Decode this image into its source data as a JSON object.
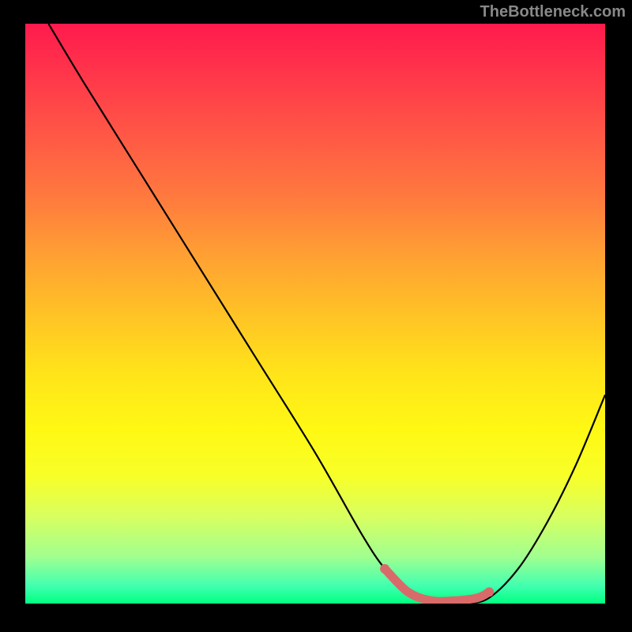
{
  "watermark": "TheBottleneck.com",
  "chart_data": {
    "type": "line",
    "title": "",
    "xlabel": "",
    "ylabel": "",
    "xlim": [
      0,
      100
    ],
    "ylim": [
      0,
      100
    ],
    "series": [
      {
        "name": "bottleneck-curve",
        "x": [
          4,
          10,
          20,
          30,
          40,
          50,
          58,
          62,
          66,
          72,
          76,
          80,
          85,
          90,
          95,
          100
        ],
        "y": [
          100,
          90,
          74,
          58,
          42,
          26,
          12,
          6,
          2,
          0,
          0,
          1,
          6,
          14,
          24,
          36
        ]
      }
    ],
    "marker_segment": {
      "name": "optimal-range",
      "x": [
        62,
        66,
        70,
        74,
        78,
        80
      ],
      "y": [
        6,
        2,
        0.5,
        0.5,
        1,
        2
      ]
    },
    "gradient_stops": [
      {
        "pos": 0,
        "color": "#ff1a4d"
      },
      {
        "pos": 50,
        "color": "#ffc226"
      },
      {
        "pos": 80,
        "color": "#f8ff28"
      },
      {
        "pos": 100,
        "color": "#00ff80"
      }
    ]
  }
}
